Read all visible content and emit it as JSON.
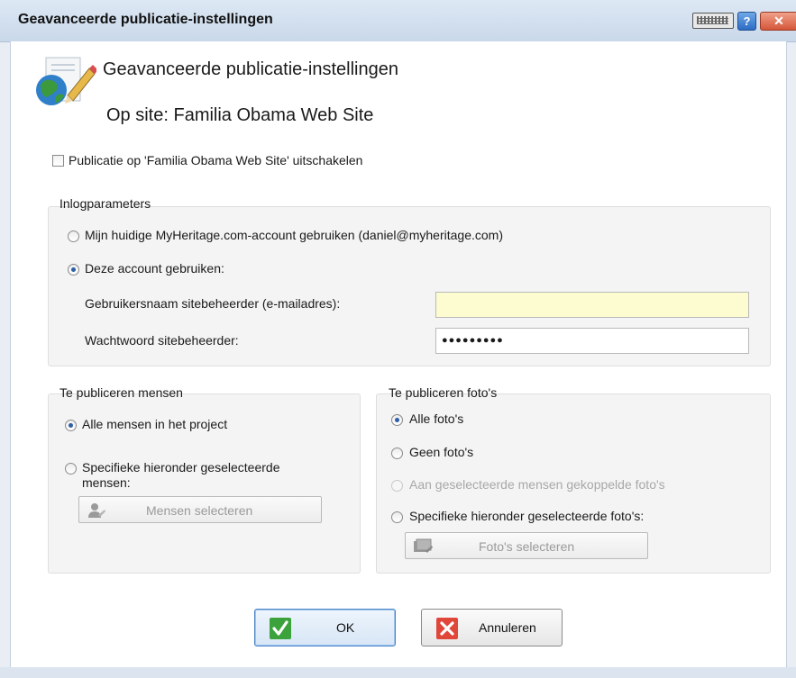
{
  "window": {
    "title": "Geavanceerde publicatie-instellingen"
  },
  "header": {
    "heading": "Geavanceerde publicatie-instellingen",
    "site_line": "Op site: Familia Obama Web Site"
  },
  "disable_publishing": {
    "label": "Publicatie op 'Familia Obama Web Site' uitschakelen",
    "checked": false
  },
  "login": {
    "legend": "Inlogparameters",
    "option_current": "Mijn huidige MyHeritage.com-account gebruiken (daniel@myheritage.com)",
    "option_this": "Deze account gebruiken:",
    "selected": "option_this",
    "username_label": "Gebruikersnaam sitebeheerder (e-mailadres):",
    "username_value": "",
    "password_label": "Wachtwoord sitebeheerder:",
    "password_value": "●●●●●●●●●"
  },
  "people": {
    "legend": "Te publiceren mensen",
    "option_all": "Alle mensen in het project",
    "option_specific_line1": "Specifieke hieronder geselecteerde",
    "option_specific_line2": "mensen:",
    "selected": "option_all",
    "select_button": "Mensen selecteren"
  },
  "photos": {
    "legend": "Te publiceren foto's",
    "option_all": "Alle foto's",
    "option_none": "Geen foto's",
    "option_linked": "Aan geselecteerde mensen gekoppelde foto's",
    "option_specific": "Specifieke hieronder geselecteerde foto's:",
    "selected": "option_all",
    "select_button": "Foto's selecteren"
  },
  "footer": {
    "ok_label": "OK",
    "cancel_label": "Annuleren"
  },
  "colors": {
    "username_field_bg": "#fdfbd0",
    "ok_check": "#3ca33c",
    "cancel_x": "#e0473a",
    "radio_selected": "#2d5fa8"
  },
  "icons": {
    "app": "globe-pencil-icon",
    "keyboard": "keyboard-icon",
    "help": "help-icon",
    "close": "close-icon",
    "people_button": "people-icon",
    "photos_button": "photos-icon",
    "ok": "check-icon",
    "cancel": "x-icon"
  }
}
